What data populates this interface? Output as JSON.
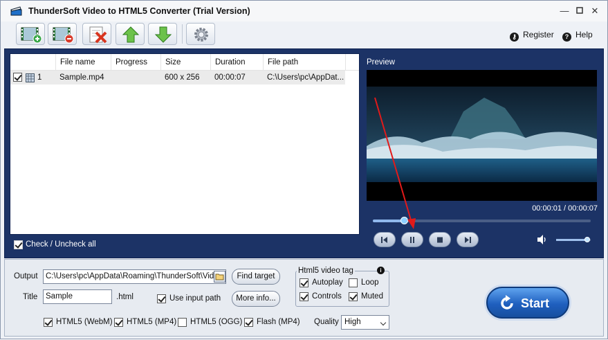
{
  "window": {
    "title": "ThunderSoft Video to HTML5 Converter (Trial Version)"
  },
  "toolbar": {
    "register_label": "Register",
    "help_label": "Help"
  },
  "file_list": {
    "columns": [
      "File name",
      "Progress",
      "Size",
      "Duration",
      "File path"
    ],
    "rows": [
      {
        "checked": true,
        "index": "1",
        "file_name": "Sample.mp4",
        "progress": "",
        "size": "600 x 256",
        "duration": "00:00:07",
        "file_path": "C:\\Users\\pc\\AppDat..."
      }
    ],
    "check_all_label": "Check / Uncheck all"
  },
  "preview": {
    "label": "Preview",
    "time_display": "00:00:01 / 00:00:07",
    "seek_fraction": 0.143,
    "volume_fraction": 0.9
  },
  "output": {
    "output_label": "Output",
    "output_path": "C:\\Users\\pc\\AppData\\Roaming\\ThunderSoft\\Video",
    "find_target_label": "Find target",
    "title_label": "Title",
    "title_value": "Sample",
    "title_suffix": ".html",
    "use_input_path_label": "Use input path",
    "use_input_path_checked": true,
    "more_info_label": "More info...",
    "html5_tag_title": "Html5 video tag",
    "autoplay_label": "Autoplay",
    "autoplay_checked": true,
    "loop_label": "Loop",
    "loop_checked": false,
    "controls_label": "Controls",
    "controls_checked": true,
    "muted_label": "Muted",
    "muted_checked": true,
    "formats": [
      {
        "label": "HTML5 (WebM)",
        "checked": true
      },
      {
        "label": "HTML5 (MP4)",
        "checked": true
      },
      {
        "label": "HTML5 (OGG)",
        "checked": false
      },
      {
        "label": "Flash (MP4)",
        "checked": true
      }
    ],
    "quality_label": "Quality",
    "quality_value": "High",
    "start_label": "Start"
  }
}
